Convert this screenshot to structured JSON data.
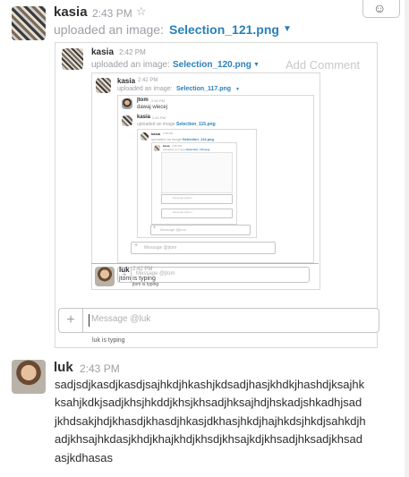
{
  "msg1": {
    "author": "kasia",
    "time": "2:43 PM",
    "star_icon": "star-icon",
    "action": "uploaded an image:",
    "file": "Selection_121.png",
    "reaction_icon": "add-reaction-icon"
  },
  "nested1": {
    "author": "kasia",
    "time": "2:42 PM",
    "action": "uploaded an image:",
    "file": "Selection_120.png",
    "add_comment": "Add Comment"
  },
  "nested2": {
    "author": "kasia",
    "time": "2:42 PM",
    "action": "uploaded an image:",
    "file": "Selection_117.png"
  },
  "nested3": {
    "jtom_author": "jtom",
    "jtom_time": "2:40 PM",
    "jtom_text": "dawaj wiecej",
    "kasia_author": "kasia",
    "kasia_time": "2:40 PM",
    "action": "uploaded an image:",
    "file": "Selection_115.png"
  },
  "nested4": {
    "author": "kasia",
    "time": "2:38 PM",
    "action": "uploaded an image:",
    "file": "Selection_114.png"
  },
  "nested5": {
    "author": "kasia",
    "time": "2:36 PM",
    "action": "uploaded an image:",
    "file": "Selection_112.png"
  },
  "tiny_inputs": {
    "p1": "Message @jtom",
    "p2": "Message @jtom",
    "p3": "Message @jtom",
    "p4": "Message @jtom"
  },
  "inner_input": {
    "plus": "+",
    "placeholder": "Message @jtom",
    "typing": "jtom is typing"
  },
  "inner_luk": {
    "author": "luk",
    "time": "2:42 PM",
    "text": "jtom is typing"
  },
  "outer_input": {
    "plus": "+",
    "placeholder": "Message @luk",
    "typing": "luk is typing"
  },
  "msg2": {
    "author": "luk",
    "time": "2:43 PM",
    "lines": [
      "sadjsdjkasdjkasdjsajhkdjhkashjkdsadjhasjkhdkjhashdjksajhk",
      "ksahjkdkjsadjkhsjhkddjkhsjkhsadjhksajhdjhskadjshkadhjsad",
      "jkhdsakjhdjkhasdjkhasdjhkasjdkhasjhkdjhajhkdsjhkdjsahkdjh",
      "adjkhsajhkdasjkhdjkhajkhdjkhsdjkhsajkdjkhsadjhksadjkhsad",
      "asjkdhasas"
    ]
  }
}
